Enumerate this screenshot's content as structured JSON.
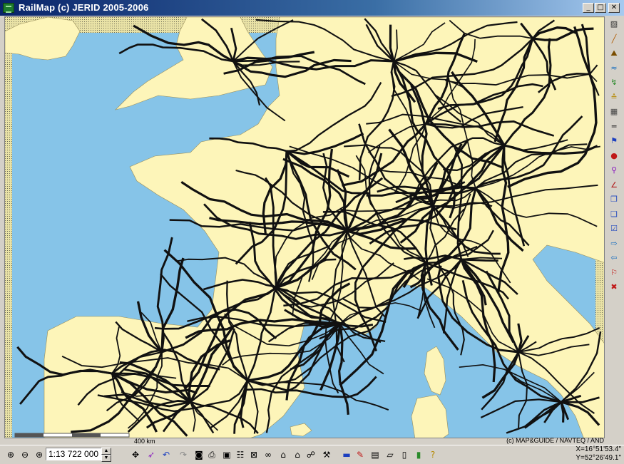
{
  "window": {
    "title": "RailMap (c) JERID 2005-2006",
    "controls": [
      "_",
      "□",
      "✕"
    ]
  },
  "map": {
    "scale_bar_label": "400 km",
    "copyright": "(c) MAP&GUIDE / NAVTEQ / AND",
    "colors": {
      "sea": "#86c4e8",
      "land": "#fdf5b9",
      "rail": "#111111",
      "outside": "#e8e0a0"
    }
  },
  "toolbar": {
    "scale_value": "1:13 722 000"
  },
  "status": {
    "x": "X=16°51'53.4\"",
    "y": "Y=52°26'49.1\""
  },
  "right_tools": [
    {
      "name": "layers-icon",
      "glyph": "▨"
    },
    {
      "name": "measure-icon",
      "glyph": "╱"
    },
    {
      "name": "profile-icon",
      "glyph": "⛰"
    },
    {
      "name": "river-icon",
      "glyph": "≈"
    },
    {
      "name": "route-icon",
      "glyph": "↯"
    },
    {
      "name": "track-icon",
      "glyph": "≙"
    },
    {
      "name": "station-icon",
      "glyph": "▦"
    },
    {
      "name": "line-icon",
      "glyph": "═"
    },
    {
      "name": "flag-icon",
      "glyph": "⚑"
    },
    {
      "name": "point-icon",
      "glyph": "●"
    },
    {
      "name": "pin-icon",
      "glyph": "⚲"
    },
    {
      "name": "draw-icon",
      "glyph": "∠"
    },
    {
      "name": "copy-icon",
      "glyph": "❐"
    },
    {
      "name": "paste-icon",
      "glyph": "❏"
    },
    {
      "name": "check-icon",
      "glyph": "☑"
    },
    {
      "name": "export-icon",
      "glyph": "⇨"
    },
    {
      "name": "import-icon",
      "glyph": "⇦"
    },
    {
      "name": "flags-icon",
      "glyph": "⚐"
    },
    {
      "name": "delete-icon",
      "glyph": "✖"
    }
  ],
  "bottom_tools": [
    {
      "name": "zoom-in-icon",
      "glyph": "⊕"
    },
    {
      "name": "zoom-out-icon",
      "glyph": "⊖"
    },
    {
      "name": "zoom-fit-icon",
      "glyph": "⊛"
    },
    {
      "name": "pan-icon",
      "glyph": "✥"
    },
    {
      "name": "select-icon",
      "glyph": "➶"
    },
    {
      "name": "undo-icon",
      "glyph": "↶"
    },
    {
      "name": "redo-icon",
      "glyph": "↷"
    },
    {
      "name": "camera-icon",
      "glyph": "◙"
    },
    {
      "name": "print-icon",
      "glyph": "⎙"
    },
    {
      "name": "save-icon",
      "glyph": "▣"
    },
    {
      "name": "properties-icon",
      "glyph": "☷"
    },
    {
      "name": "clear-icon",
      "glyph": "⊠"
    },
    {
      "name": "find-icon",
      "glyph": "∞"
    },
    {
      "name": "town-icon",
      "glyph": "⌂"
    },
    {
      "name": "towns-icon",
      "glyph": "⌂"
    },
    {
      "name": "network-icon",
      "glyph": "☍"
    },
    {
      "name": "tool-icon",
      "glyph": "⚒"
    },
    {
      "name": "train-icon",
      "glyph": "▬"
    },
    {
      "name": "pencil-icon",
      "glyph": "✎"
    },
    {
      "name": "table-icon",
      "glyph": "▤"
    },
    {
      "name": "open-icon",
      "glyph": "▱"
    },
    {
      "name": "doc-icon",
      "glyph": "▯"
    },
    {
      "name": "report-icon",
      "glyph": "▮"
    },
    {
      "name": "help-icon",
      "glyph": "?"
    }
  ]
}
